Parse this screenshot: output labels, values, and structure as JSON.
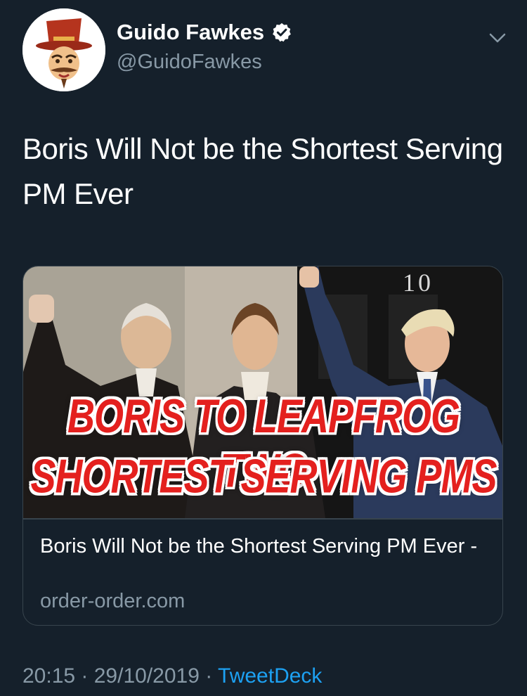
{
  "author": {
    "display_name": "Guido Fawkes",
    "handle": "@GuidoFawkes",
    "verified": true
  },
  "tweet": {
    "text": "Boris Will Not be the Shortest Serving PM Ever"
  },
  "card": {
    "image_headline_line1": "BORIS TO LEAPFROG TWO",
    "image_headline_line2": "SHORTEST SERVING PMS",
    "image_door_number": "10",
    "title": "Boris Will Not be the Shortest Serving PM Ever -",
    "domain": "order-order.com"
  },
  "meta": {
    "time": "20:15",
    "separator": " · ",
    "date": "29/10/2019",
    "source": "TweetDeck"
  },
  "icons": {
    "verified": "verified-badge-icon",
    "more": "chevron-down-icon"
  },
  "colors": {
    "background": "#15202b",
    "secondary_text": "#8899a6",
    "link": "#1da1f2",
    "border": "#38444d",
    "headline_red": "#e4201e"
  }
}
